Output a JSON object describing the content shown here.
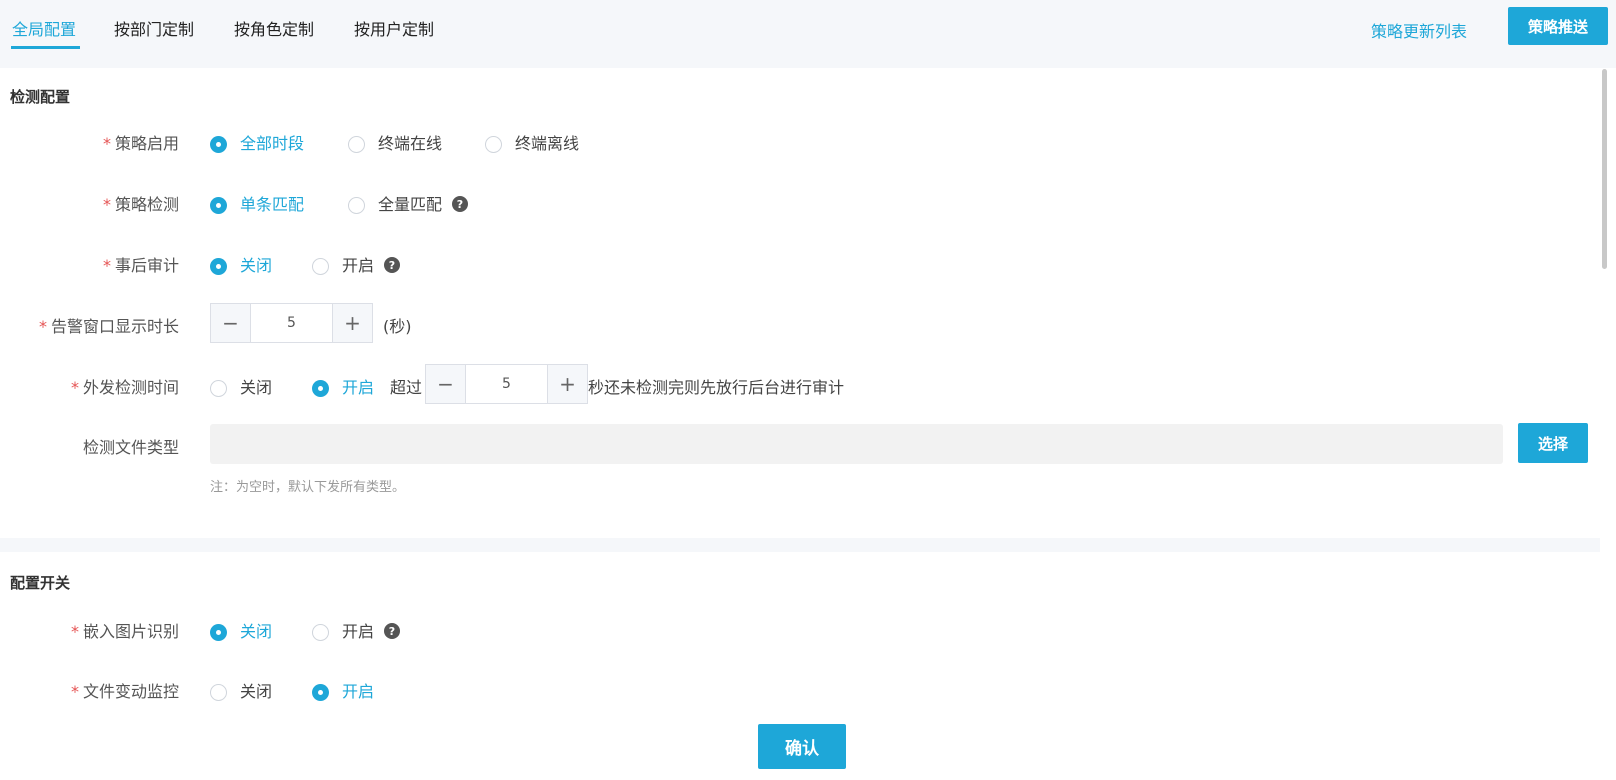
{
  "tabs": [
    {
      "label": "全局配置",
      "active": true
    },
    {
      "label": "按部门定制",
      "active": false
    },
    {
      "label": "按角色定制",
      "active": false
    },
    {
      "label": "按用户定制",
      "active": false
    }
  ],
  "header": {
    "update_list_label": "策略更新列表",
    "push_label": "策略推送"
  },
  "colors": {
    "accent": "#1ea7d8",
    "required": "#e55353"
  },
  "detect": {
    "title": "检测配置",
    "strategy_enable": {
      "label": "策略启用",
      "options": [
        "全部时段",
        "终端在线",
        "终端离线"
      ],
      "selected": "全部时段"
    },
    "strategy_detect": {
      "label": "策略检测",
      "options": [
        "单条匹配",
        "全量匹配"
      ],
      "selected": "单条匹配"
    },
    "post_audit": {
      "label": "事后审计",
      "options": [
        "关闭",
        "开启"
      ],
      "selected": "关闭"
    },
    "alert_duration": {
      "label": "告警窗口显示时长",
      "value": "5",
      "unit": "(秒)"
    },
    "outgoing_time": {
      "label": "外发检测时间",
      "options": [
        "关闭",
        "开启"
      ],
      "selected": "开启",
      "prefix": "超过",
      "value": "5",
      "suffix": "秒还未检测完则先放行后台进行审计"
    },
    "file_types": {
      "label": "检测文件类型",
      "select_label": "选择",
      "note": "注：为空时，默认下发所有类型。"
    }
  },
  "switches": {
    "title": "配置开关",
    "embed_image": {
      "label": "嵌入图片识别",
      "options": [
        "关闭",
        "开启"
      ],
      "selected": "关闭"
    },
    "file_change": {
      "label": "文件变动监控",
      "options": [
        "关闭",
        "开启"
      ],
      "selected": "开启"
    }
  },
  "icons": {
    "required": "asterisk",
    "help": "question-circle-icon"
  },
  "footer": {
    "confirm_label": "确认"
  }
}
